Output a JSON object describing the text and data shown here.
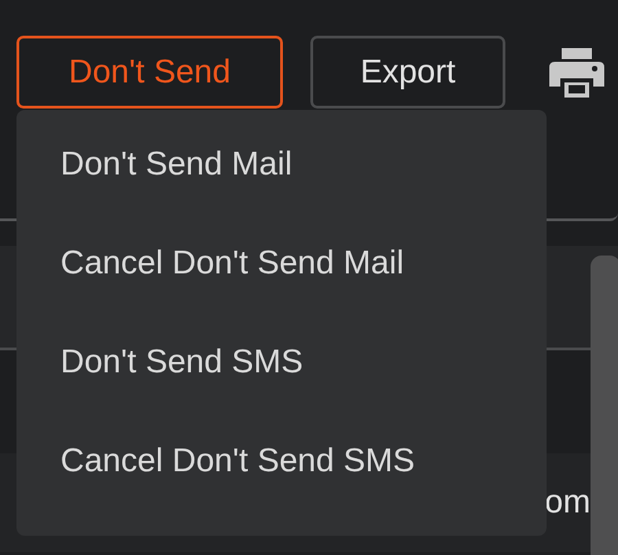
{
  "toolbar": {
    "dont_send_button": "Don't Send",
    "export_button": "Export"
  },
  "menu": {
    "items": [
      "Don't Send Mail",
      "Cancel Don't Send Mail",
      "Don't Send SMS",
      "Cancel Don't Send SMS"
    ]
  },
  "list": {
    "row_text": "om"
  }
}
